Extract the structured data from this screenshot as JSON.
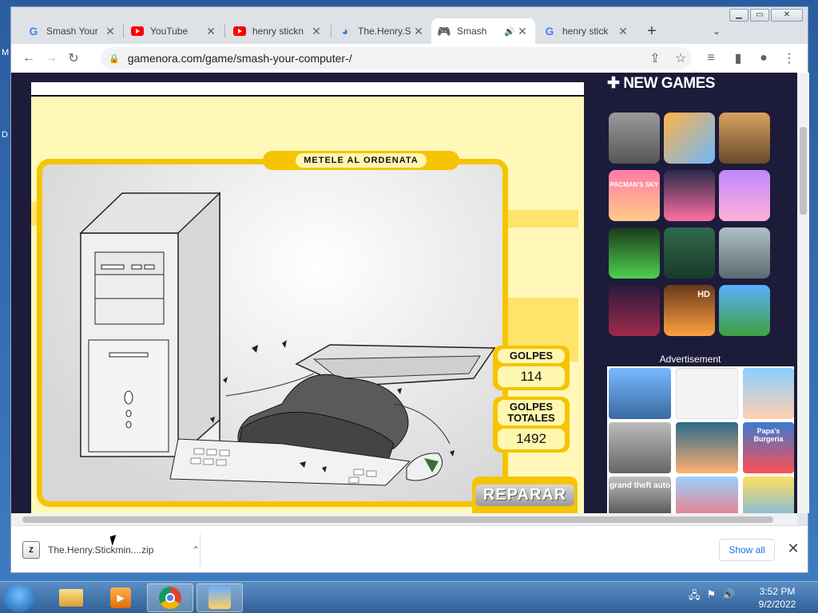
{
  "browser": {
    "tabs": [
      {
        "title": "Smash Your",
        "favicon": "google-icon"
      },
      {
        "title": "YouTube",
        "favicon": "youtube-icon"
      },
      {
        "title": "henry stickn",
        "favicon": "youtube-icon"
      },
      {
        "title": "The.Henry.S",
        "favicon": "edge-icon"
      },
      {
        "title": "Smash",
        "favicon": "gamepad-icon",
        "active": true
      },
      {
        "title": "henry stick",
        "favicon": "google-icon"
      }
    ],
    "new_tab": "+",
    "url": "gamenora.com/game/smash-your-computer-/"
  },
  "game": {
    "title": "METELE AL ORDENATA",
    "hits_label": "GOLPES",
    "hits_value": "114",
    "total_label_1": "GOLPES",
    "total_label_2": "TOTALES",
    "total_value": "1492",
    "repair_label": "REPARAR"
  },
  "sidebar": {
    "heading": "NEW GAMES",
    "ad_label": "Advertisement",
    "thumb_texts": [
      "PACMAN'S SKY",
      "HD"
    ],
    "ad_texts": [
      "Papa's Burgeria",
      "grand theft auto"
    ]
  },
  "downloads": {
    "file": "The.Henry.Stickmin....zip",
    "show_all": "Show all"
  },
  "taskbar": {
    "time": "3:52 PM",
    "date": "9/2/2022"
  },
  "desktop": {
    "letters": [
      "M",
      "D"
    ]
  },
  "colors": {
    "accent_yellow": "#f6c400",
    "page_bg": "#1d1b3a",
    "link_blue": "#1a73e8"
  }
}
